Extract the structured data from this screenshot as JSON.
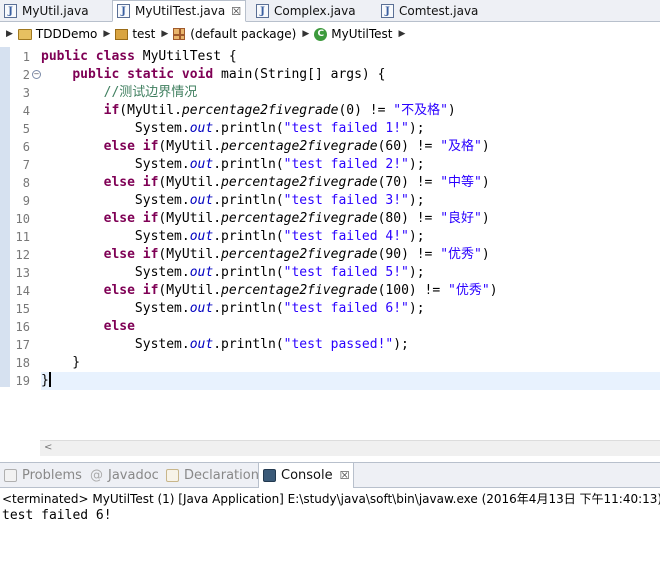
{
  "editor_tabs": [
    {
      "label": "MyUtil.java",
      "active": false
    },
    {
      "label": "MyUtilTest.java",
      "active": true,
      "close": "☒"
    },
    {
      "label": "Complex.java",
      "active": false
    },
    {
      "label": "Comtest.java",
      "active": false
    }
  ],
  "breadcrumb": {
    "project": "TDDDemo",
    "source_folder": "test",
    "package": "(default package)",
    "class": "MyUtilTest"
  },
  "line_numbers": [
    "1",
    "2",
    "3",
    "4",
    "5",
    "6",
    "7",
    "8",
    "9",
    "10",
    "11",
    "12",
    "13",
    "14",
    "15",
    "16",
    "17",
    "18",
    "19"
  ],
  "code": {
    "l1": {
      "kw1": "public",
      "kw2": "class",
      "rest": " MyUtilTest {"
    },
    "l2": {
      "indent": "    ",
      "kw1": "public",
      "kw2": "static",
      "kw3": "void",
      "rest": " main(String[] args) {"
    },
    "l3": {
      "indent": "        ",
      "comment": "//测试边界情况"
    },
    "checks": [
      {
        "indent": "        ",
        "kw": "if",
        "open": "(MyUtil.",
        "method": "percentage2fivegrade",
        "arg": "(0) != ",
        "str": "\"不及格\"",
        "close": ")"
      },
      {
        "indent": "        ",
        "kw": "else if",
        "open": "(MyUtil.",
        "method": "percentage2fivegrade",
        "arg": "(60) != ",
        "str": "\"及格\"",
        "close": ")"
      },
      {
        "indent": "        ",
        "kw": "else if",
        "open": "(MyUtil.",
        "method": "percentage2fivegrade",
        "arg": "(70) != ",
        "str": "\"中等\"",
        "close": ")"
      },
      {
        "indent": "        ",
        "kw": "else if",
        "open": "(MyUtil.",
        "method": "percentage2fivegrade",
        "arg": "(80) != ",
        "str": "\"良好\"",
        "close": ")"
      },
      {
        "indent": "        ",
        "kw": "else if",
        "open": "(MyUtil.",
        "method": "percentage2fivegrade",
        "arg": "(90) != ",
        "str": "\"优秀\"",
        "close": ")"
      },
      {
        "indent": "        ",
        "kw": "else if",
        "open": "(MyUtil.",
        "method": "percentage2fivegrade",
        "arg": "(100) != ",
        "str": "\"优秀\"",
        "close": ")"
      }
    ],
    "prints": [
      {
        "indent": "            ",
        "pre": "System.",
        "field": "out",
        "call": ".println(",
        "str": "\"test failed 1!\"",
        "end": ");"
      },
      {
        "indent": "            ",
        "pre": "System.",
        "field": "out",
        "call": ".println(",
        "str": "\"test failed 2!\"",
        "end": ");"
      },
      {
        "indent": "            ",
        "pre": "System.",
        "field": "out",
        "call": ".println(",
        "str": "\"test failed 3!\"",
        "end": ");"
      },
      {
        "indent": "            ",
        "pre": "System.",
        "field": "out",
        "call": ".println(",
        "str": "\"test failed 4!\"",
        "end": ");"
      },
      {
        "indent": "            ",
        "pre": "System.",
        "field": "out",
        "call": ".println(",
        "str": "\"test failed 5!\"",
        "end": ");"
      },
      {
        "indent": "            ",
        "pre": "System.",
        "field": "out",
        "call": ".println(",
        "str": "\"test failed 6!\"",
        "end": ");"
      }
    ],
    "l16": {
      "indent": "        ",
      "kw": "else"
    },
    "l17": {
      "indent": "            ",
      "pre": "System.",
      "field": "out",
      "call": ".println(",
      "str": "\"test passed!\"",
      "end": ");"
    },
    "l18": {
      "text": "    }"
    },
    "l19": {
      "text": "}"
    }
  },
  "scroll_arrow": "<",
  "view_tabs": [
    {
      "label": "Problems",
      "prefix": "",
      "active": false
    },
    {
      "label": "Javadoc",
      "prefix": "@",
      "active": false
    },
    {
      "label": "Declaration",
      "prefix": "",
      "active": false
    },
    {
      "label": "Console",
      "prefix": "",
      "active": true,
      "close": "☒"
    }
  ],
  "console": {
    "status": "<terminated> MyUtilTest (1) [Java Application] E:\\study\\java\\soft\\bin\\javaw.exe (2016年4月13日 下午11:40:13)",
    "output": "test failed 6!"
  }
}
